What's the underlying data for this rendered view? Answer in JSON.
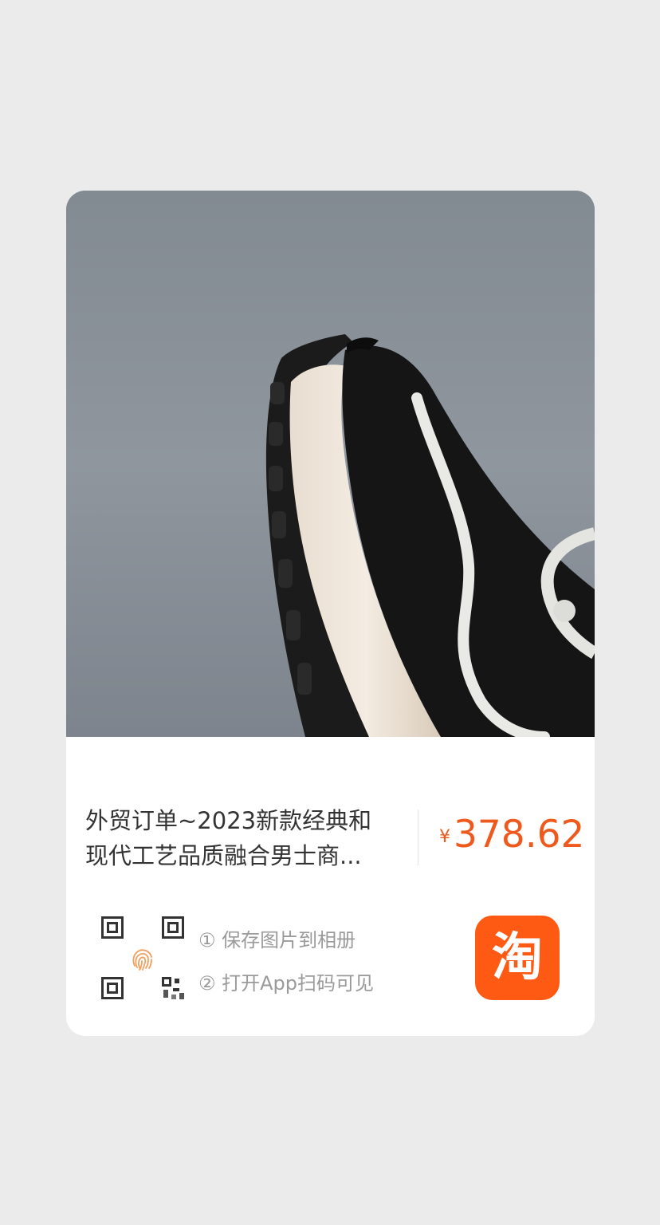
{
  "product": {
    "image_icon": "sneaker-photo",
    "title_line1": "外贸订单~2023新款经典和",
    "title_line2": "现代工艺品质融合男士商...",
    "currency": "¥",
    "price": "378.62",
    "price_color": "#ee5a1e"
  },
  "scan": {
    "qr_icon": "qr-code-icon",
    "fingerprint_icon": "fingerprint-icon",
    "step1": "① 保存图片到相册",
    "step2": "② 打开App扫码可见"
  },
  "app": {
    "icon": "taobao-app-icon",
    "label": "淘",
    "color": "#ff5a14"
  }
}
